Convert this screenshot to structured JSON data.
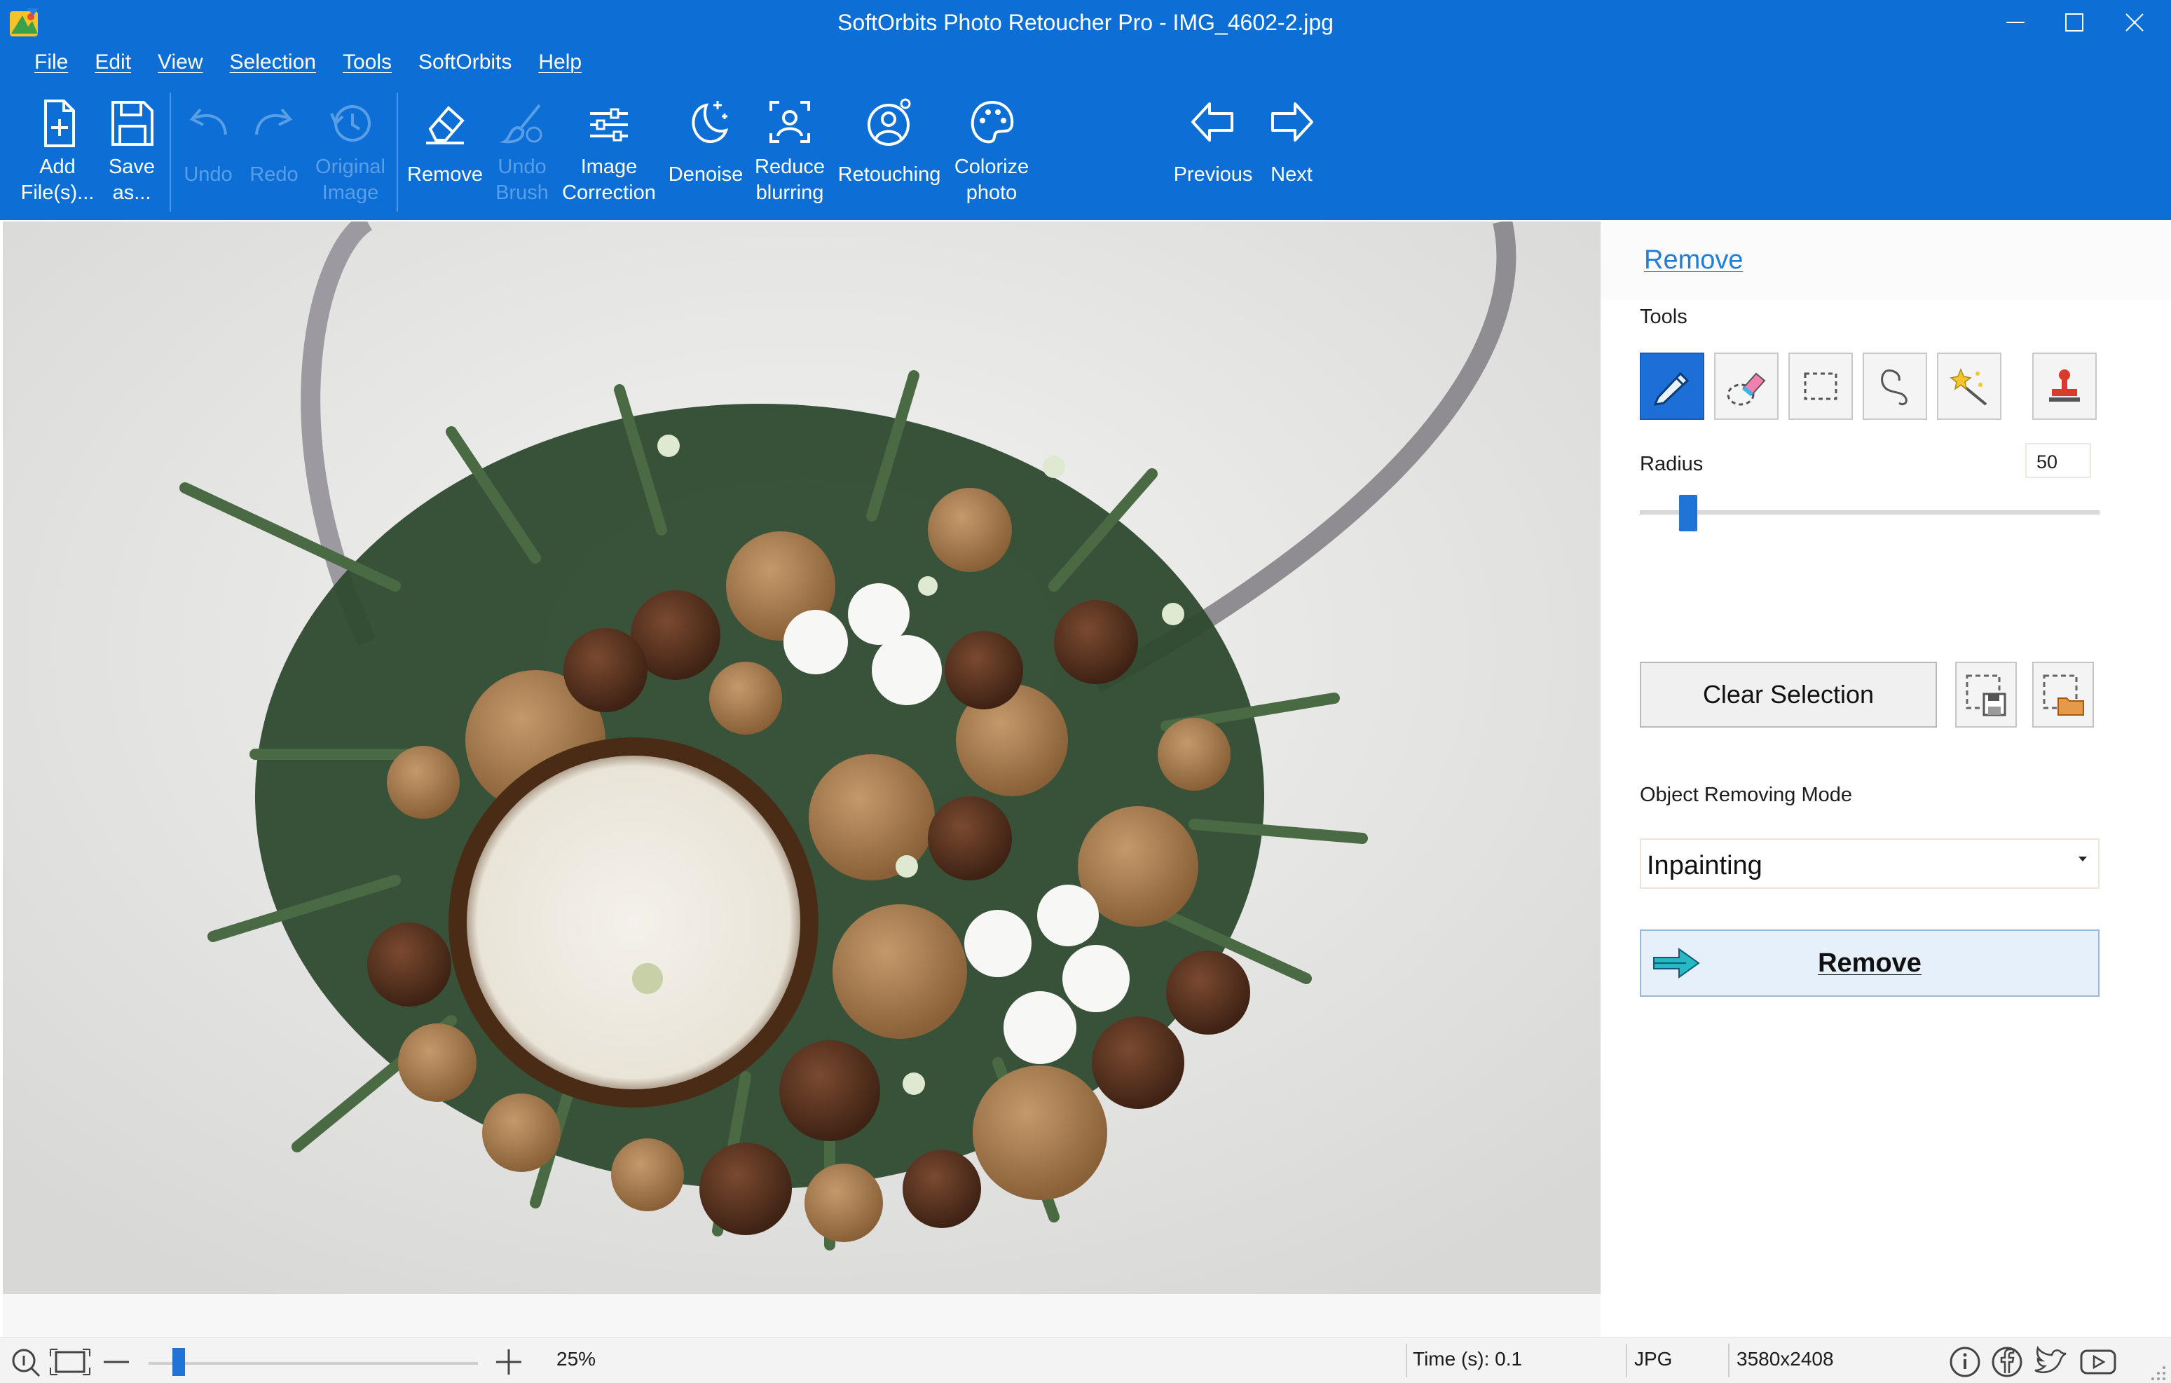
{
  "window": {
    "title": "SoftOrbits Photo Retoucher Pro - IMG_4602-2.jpg",
    "minimize": "minimize-icon",
    "maximize": "maximize-icon",
    "close": "close-icon"
  },
  "menu": [
    "File",
    "Edit",
    "View",
    "Selection",
    "Tools",
    "SoftOrbits",
    "Help"
  ],
  "ribbon": {
    "add_files": "Add\nFile(s)...",
    "save_as": "Save\nas...",
    "undo": "Undo",
    "redo": "Redo",
    "original_image": "Original\nImage",
    "remove": "Remove",
    "undo_brush": "Undo\nBrush",
    "image_correction": "Image\nCorrection",
    "denoise": "Denoise",
    "reduce_blurring": "Reduce\nblurring",
    "retouching": "Retouching",
    "colorize_photo": "Colorize\nphoto",
    "previous": "Previous",
    "next": "Next"
  },
  "panel": {
    "title": "Remove",
    "tools_label": "Tools",
    "tools": [
      "pencil-icon",
      "eraser-icon",
      "rect-select-icon",
      "lasso-icon",
      "magic-wand-icon",
      "stamp-icon"
    ],
    "radius_label": "Radius",
    "radius_value": "50",
    "radius_fraction": 0.07,
    "clear_selection": "Clear Selection",
    "save_selection": "save-selection-icon",
    "load_selection": "load-selection-icon",
    "mode_label": "Object Removing Mode",
    "mode_value": "Inpainting",
    "remove_button": "Remove"
  },
  "status": {
    "zoom": "25%",
    "time": "Time (s): 0.1",
    "format": "JPG",
    "size": "3580x2408"
  },
  "colors": {
    "header": "#0d6fd6",
    "accent": "#1f74d6",
    "panel_title": "#1e7ed9"
  }
}
